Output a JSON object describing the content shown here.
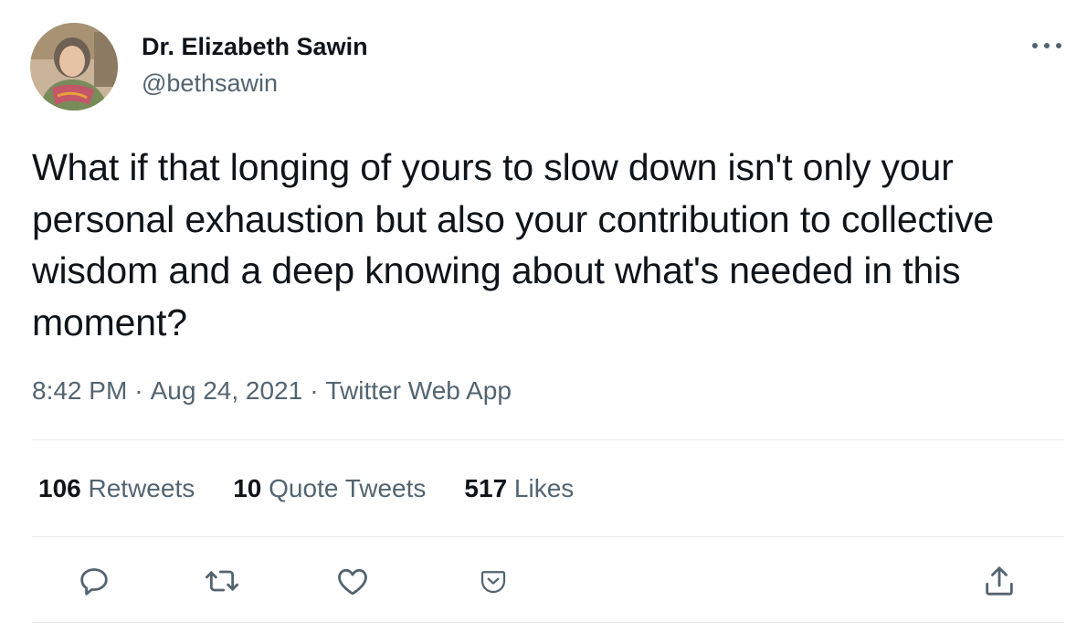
{
  "author": {
    "display_name": "Dr. Elizabeth Sawin",
    "handle": "@bethsawin",
    "avatar_icon": "profile-photo"
  },
  "tweet": {
    "text": "What if that longing of yours to slow down isn't only your personal exhaustion but also your contribution to collective wisdom and a deep knowing about what's needed in this moment?",
    "time": "8:42 PM",
    "date": "Aug 24, 2021",
    "separator": "·",
    "source": "Twitter Web App"
  },
  "stats": {
    "retweets": {
      "count": "106",
      "label": "Retweets"
    },
    "quote_tweets": {
      "count": "10",
      "label": "Quote Tweets"
    },
    "likes": {
      "count": "517",
      "label": "Likes"
    }
  },
  "actions": [
    {
      "icon": "reply-icon"
    },
    {
      "icon": "retweet-icon"
    },
    {
      "icon": "like-icon"
    },
    {
      "icon": "bookmark-icon"
    },
    {
      "icon": "share-icon"
    }
  ],
  "more_icon": "more-options-icon",
  "colors": {
    "text_primary": "#0f1419",
    "text_secondary": "#536471",
    "divider": "#e6ecf0"
  }
}
